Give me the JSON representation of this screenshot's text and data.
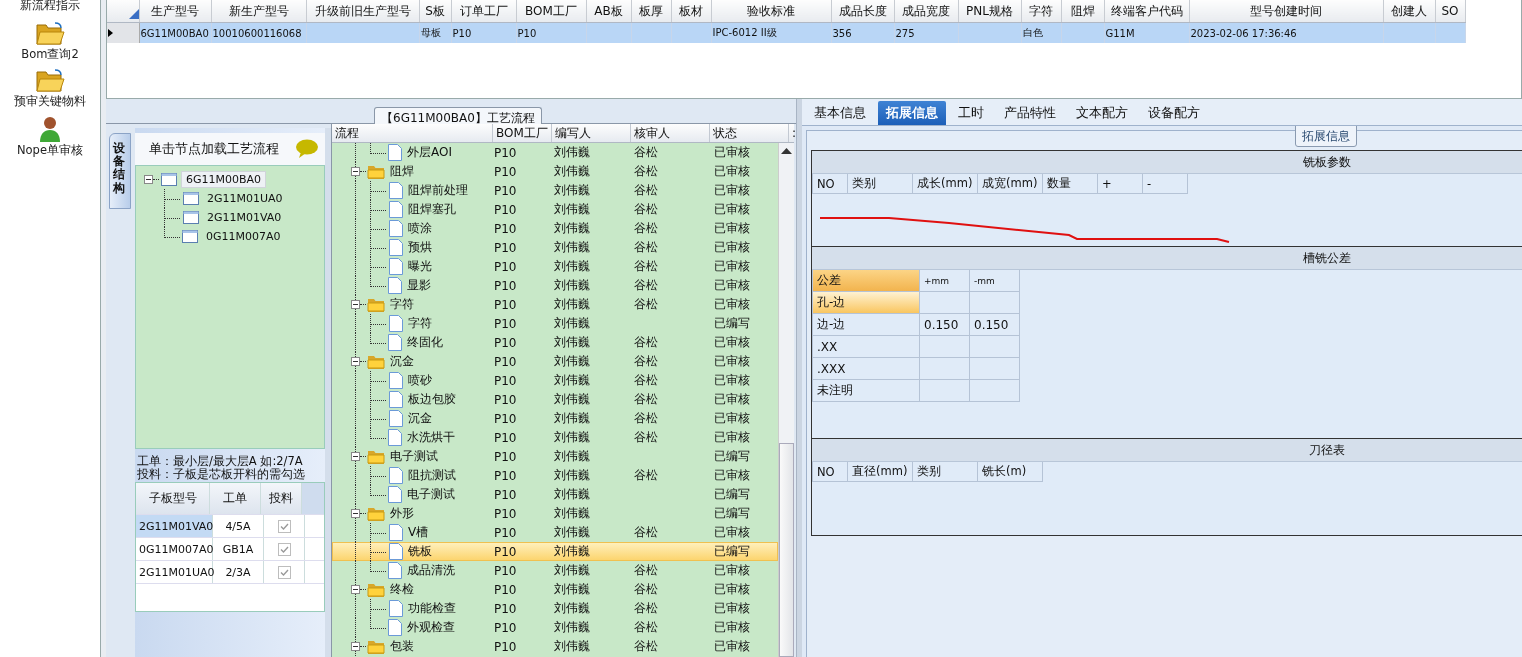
{
  "sidebar": {
    "items": [
      {
        "label": "新流程指示",
        "kind": "text"
      },
      {
        "label": "Bom查询2",
        "kind": "folder"
      },
      {
        "label": "预审关键物料",
        "kind": "folder"
      },
      {
        "label": "Nope单审核",
        "kind": "person"
      }
    ]
  },
  "top_grid": {
    "columns": [
      "生产型号",
      "新生产型号",
      "升级前旧生产型号",
      "S板",
      "订单工厂",
      "BOM工厂",
      "AB板",
      "板厚",
      "板材",
      "验收标准",
      "成品长度",
      "成品宽度",
      "PNL规格",
      "字符",
      "阻焊",
      "终端客户代码",
      "型号创建时间",
      "创建人",
      "SO"
    ],
    "rows": [
      {
        "selected": true,
        "cells": [
          "6G11M00BA0",
          "10010600116068",
          null,
          "母板",
          "P10",
          "P10",
          null,
          null,
          null,
          "IPC-6012 II级",
          "356",
          "275",
          null,
          "白色",
          null,
          "G11M",
          "2023-02-06 17:36:46",
          null,
          null
        ]
      }
    ]
  },
  "flow_panel": {
    "title": "【6G11M00BA0】工艺流程",
    "side_tab": "设备结构",
    "tree_header": "单击节点加载工艺流程",
    "tree": {
      "label": "6G11M00BA0",
      "selected": true,
      "expanded": true,
      "children": [
        {
          "label": "2G11M01UA0",
          "selected": false
        },
        {
          "label": "2G11M01VA0",
          "selected": false
        },
        {
          "label": "0G11M007A0",
          "selected": false
        }
      ]
    },
    "notes": [
      "工单：最小层/最大层A 如:2/7A",
      "投料：子板是芯板开料的需勾选"
    ],
    "sub_grid": {
      "columns": [
        "子板型号",
        "工单",
        "投料"
      ],
      "rows": [
        {
          "model": "2G11M01VA0",
          "order": "4/5A",
          "checked": true,
          "disabled": true,
          "selected": true
        },
        {
          "model": "0G11M007A0",
          "order": "GB1A",
          "checked": true,
          "disabled": true,
          "selected": false
        },
        {
          "model": "2G11M01UA0",
          "order": "2/3A",
          "checked": true,
          "disabled": true,
          "selected": false
        }
      ]
    },
    "flow_grid": {
      "columns": [
        "流程",
        "BOM工厂",
        "编写人",
        "核审人",
        "状态",
        ":"
      ],
      "rows": [
        {
          "kind": "leaf",
          "name": "外层AOI",
          "bom": "P10",
          "writer": "刘伟巍",
          "reviewer": "谷松",
          "status": "已审核",
          "selected": false
        },
        {
          "kind": "folder",
          "name": "阻焊",
          "bom": "P10",
          "writer": "刘伟巍",
          "reviewer": "谷松",
          "status": "已审核",
          "selected": false,
          "expanded": true,
          "children": [
            {
              "kind": "leaf",
              "name": "阻焊前处理",
              "bom": "P10",
              "writer": "刘伟巍",
              "reviewer": "谷松",
              "status": "已审核",
              "selected": false
            },
            {
              "kind": "leaf",
              "name": "阻焊塞孔",
              "bom": "P10",
              "writer": "刘伟巍",
              "reviewer": "谷松",
              "status": "已审核",
              "selected": false
            },
            {
              "kind": "leaf",
              "name": "喷涂",
              "bom": "P10",
              "writer": "刘伟巍",
              "reviewer": "谷松",
              "status": "已审核",
              "selected": false
            },
            {
              "kind": "leaf",
              "name": "预烘",
              "bom": "P10",
              "writer": "刘伟巍",
              "reviewer": "谷松",
              "status": "已审核",
              "selected": false
            },
            {
              "kind": "leaf",
              "name": "曝光",
              "bom": "P10",
              "writer": "刘伟巍",
              "reviewer": "谷松",
              "status": "已审核",
              "selected": false
            },
            {
              "kind": "leaf",
              "name": "显影",
              "bom": "P10",
              "writer": "刘伟巍",
              "reviewer": "谷松",
              "status": "已审核",
              "selected": false
            }
          ]
        },
        {
          "kind": "folder",
          "name": "字符",
          "bom": "P10",
          "writer": "刘伟巍",
          "reviewer": "谷松",
          "status": "已审核",
          "selected": false,
          "expanded": true,
          "children": [
            {
              "kind": "leaf",
              "name": "字符",
              "bom": "P10",
              "writer": "刘伟巍",
              "status": "已编写",
              "selected": false
            },
            {
              "kind": "leaf",
              "name": "终固化",
              "bom": "P10",
              "writer": "刘伟巍",
              "reviewer": "谷松",
              "status": "已审核",
              "selected": false
            }
          ]
        },
        {
          "kind": "folder",
          "name": "沉金",
          "bom": "P10",
          "writer": "刘伟巍",
          "reviewer": "谷松",
          "status": "已审核",
          "selected": false,
          "expanded": true,
          "children": [
            {
              "kind": "leaf",
              "name": "喷砂",
              "bom": "P10",
              "writer": "刘伟巍",
              "reviewer": "谷松",
              "status": "已审核",
              "selected": false
            },
            {
              "kind": "leaf",
              "name": "板边包胶",
              "bom": "P10",
              "writer": "刘伟巍",
              "reviewer": "谷松",
              "status": "已审核",
              "selected": false
            },
            {
              "kind": "leaf",
              "name": "沉金",
              "bom": "P10",
              "writer": "刘伟巍",
              "reviewer": "谷松",
              "status": "已审核",
              "selected": false
            },
            {
              "kind": "leaf",
              "name": "水洗烘干",
              "bom": "P10",
              "writer": "刘伟巍",
              "reviewer": "谷松",
              "status": "已审核",
              "selected": false
            }
          ]
        },
        {
          "kind": "folder",
          "name": "电子测试",
          "bom": "P10",
          "writer": "刘伟巍",
          "status": "已编写",
          "selected": false,
          "expanded": true,
          "children": [
            {
              "kind": "leaf",
              "name": "阻抗测试",
              "bom": "P10",
              "writer": "刘伟巍",
              "reviewer": "谷松",
              "status": "已审核",
              "selected": false
            },
            {
              "kind": "leaf",
              "name": "电子测试",
              "bom": "P10",
              "writer": "刘伟巍",
              "status": "已编写",
              "selected": false
            }
          ]
        },
        {
          "kind": "folder",
          "name": "外形",
          "bom": "P10",
          "writer": "刘伟巍",
          "status": "已编写",
          "selected": false,
          "expanded": true,
          "children": [
            {
              "kind": "leaf",
              "name": "V槽",
              "bom": "P10",
              "writer": "刘伟巍",
              "reviewer": "谷松",
              "status": "已审核",
              "selected": false
            },
            {
              "kind": "leaf",
              "name": "铣板",
              "bom": "P10",
              "writer": "刘伟巍",
              "status": "已编写",
              "selected": true
            },
            {
              "kind": "leaf",
              "name": "成品清洗",
              "bom": "P10",
              "writer": "刘伟巍",
              "reviewer": "谷松",
              "status": "已审核",
              "selected": false
            }
          ]
        },
        {
          "kind": "folder",
          "name": "终检",
          "bom": "P10",
          "writer": "刘伟巍",
          "reviewer": "谷松",
          "status": "已审核",
          "selected": false,
          "expanded": true,
          "children": [
            {
              "kind": "leaf",
              "name": "功能检查",
              "bom": "P10",
              "writer": "刘伟巍",
              "reviewer": "谷松",
              "status": "已审核",
              "selected": false
            },
            {
              "kind": "leaf",
              "name": "外观检查",
              "bom": "P10",
              "writer": "刘伟巍",
              "reviewer": "谷松",
              "status": "已审核",
              "selected": false
            }
          ]
        },
        {
          "kind": "folder",
          "name": "包装",
          "bom": "P10",
          "writer": "刘伟巍",
          "reviewer": "谷松",
          "status": "已审核",
          "selected": false,
          "expanded": true
        }
      ]
    }
  },
  "detail_panel": {
    "tabs": [
      {
        "label": "基本信息",
        "selected": false
      },
      {
        "label": "拓展信息",
        "selected": true
      },
      {
        "label": "工时",
        "selected": false
      },
      {
        "label": "产品特性",
        "selected": false
      },
      {
        "label": "文本配方",
        "selected": false
      },
      {
        "label": "设备配方",
        "selected": false
      }
    ],
    "group_title": "拓展信息",
    "mill_params": {
      "title": "铣板参数",
      "columns": [
        "NO",
        "类别",
        "成长(mm)",
        "成宽(mm)",
        "数量",
        "+",
        "-"
      ]
    },
    "slot_tolerance": {
      "title": "槽铣公差",
      "columns": [
        "公差",
        "+mm",
        "-mm"
      ],
      "rows": [
        {
          "label": "孔-边",
          "selected": true
        },
        {
          "label": "边-边",
          "plus": "0.150",
          "minus": "0.150",
          "selected": false
        },
        {
          "label": ".XX",
          "selected": false
        },
        {
          "label": ".XXX",
          "selected": false
        },
        {
          "label": "未注明",
          "selected": false
        }
      ]
    },
    "tool_table": {
      "title": "刀径表",
      "columns": [
        "NO",
        "直径(mm)",
        "类别",
        "铣长(m)"
      ]
    }
  }
}
